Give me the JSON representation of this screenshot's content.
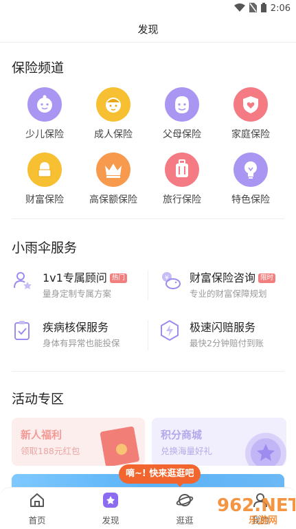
{
  "status_bar": {
    "time": "2:06"
  },
  "header": {
    "title": "发现"
  },
  "insurance": {
    "title": "保险频道",
    "items": [
      {
        "label": "少儿保险",
        "icon": "child-face-icon",
        "color": "#a996f2"
      },
      {
        "label": "成人保险",
        "icon": "adult-face-icon",
        "color": "#f6c032"
      },
      {
        "label": "父母保险",
        "icon": "parent-face-icon",
        "color": "#a996f2"
      },
      {
        "label": "家庭保险",
        "icon": "home-shield-icon",
        "color": "#f47b84"
      },
      {
        "label": "财富保险",
        "icon": "money-bag-icon",
        "color": "#f6c032"
      },
      {
        "label": "高保额保险",
        "icon": "crown-icon",
        "color": "#f79a4e"
      },
      {
        "label": "旅行保险",
        "icon": "suitcase-icon",
        "color": "#f47b84"
      },
      {
        "label": "特色保险",
        "icon": "lightbulb-icon",
        "color": "#a996f2"
      }
    ]
  },
  "services": {
    "title": "小雨伞服务",
    "items": [
      {
        "title": "1v1专属顾问",
        "tag": "热门",
        "subtitle": "量身定制专属方案",
        "icon": "advisor-icon"
      },
      {
        "title": "财富保险咨询",
        "tag": "限时",
        "subtitle": "专业的财富保障规划",
        "icon": "piggy-bank-icon"
      },
      {
        "title": "疾病核保服务",
        "tag": "",
        "subtitle": "身体有异常也能投保",
        "icon": "clipboard-check-icon"
      },
      {
        "title": "极速闪赔服务",
        "tag": "",
        "subtitle": "最快2分钟赔付到账",
        "icon": "lightning-icon"
      }
    ]
  },
  "activity": {
    "title": "活动专区",
    "cards": [
      {
        "title": "新人福利",
        "subtitle": "领取188元红包"
      },
      {
        "title": "积分商城",
        "subtitle": "兑换海量好礼"
      }
    ]
  },
  "bubble": {
    "text": "嘀~! 快来逛逛吧"
  },
  "tabbar": {
    "tabs": [
      {
        "label": "首页",
        "icon": "home-icon"
      },
      {
        "label": "发现",
        "icon": "discover-icon"
      },
      {
        "label": "逛逛",
        "icon": "planet-icon"
      },
      {
        "label": "我的",
        "icon": "user-icon"
      }
    ]
  },
  "watermark": {
    "text": "962.NET",
    "subtext": "乐游网"
  },
  "colors": {
    "accent": "#8b6cf0",
    "hot_tag": "#f27e7e",
    "bubble": "#f2652e"
  }
}
